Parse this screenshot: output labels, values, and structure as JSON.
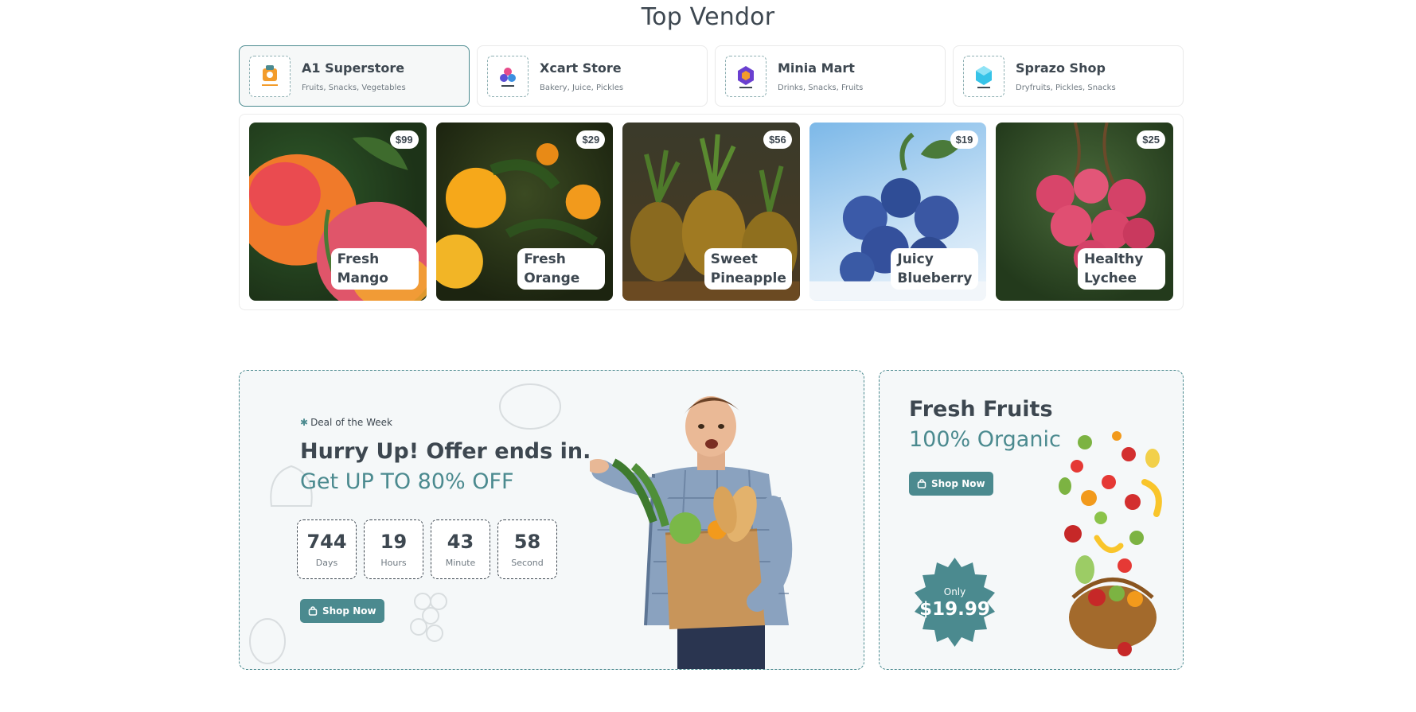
{
  "section_title": "Top Vendor",
  "vendors": [
    {
      "name": "A1 Superstore",
      "categories": "Fruits, Snacks, Vegetables",
      "active": true
    },
    {
      "name": "Xcart Store",
      "categories": "Bakery, Juice, Pickles",
      "active": false
    },
    {
      "name": "Minia Mart",
      "categories": "Drinks, Snacks, Fruits",
      "active": false
    },
    {
      "name": "Sprazo Shop",
      "categories": "Dryfruits, Pickles, Snacks",
      "active": false
    }
  ],
  "products": [
    {
      "name": "Fresh Mango",
      "price": "$99"
    },
    {
      "name": "Fresh Orange",
      "price": "$29"
    },
    {
      "name": "Sweet Pineapple",
      "price": "$56"
    },
    {
      "name": "Juicy Blueberry",
      "price": "$19"
    },
    {
      "name": "Healthy Lychee",
      "price": "$25"
    }
  ],
  "deal": {
    "eyebrow": "Deal of the Week",
    "title": "Hurry Up! Offer ends in.",
    "subtitle": "Get UP TO 80% OFF",
    "countdown": [
      {
        "value": "744",
        "label": "Days"
      },
      {
        "value": "19",
        "label": "Hours"
      },
      {
        "value": "43",
        "label": "Minute"
      },
      {
        "value": "58",
        "label": "Second"
      }
    ],
    "button_label": "Shop Now"
  },
  "fruits_banner": {
    "title": "Fresh Fruits",
    "subtitle": "100% Organic",
    "button_label": "Shop Now",
    "only_label": "Only",
    "price": "$19.99"
  },
  "colors": {
    "accent": "#4b8a8f",
    "text": "#3d4750",
    "muted": "#707a82",
    "panel": "#f5f8f9"
  },
  "icons": {
    "button_icon": "shopping-bag-icon",
    "eyebrow_icon": "star-icon"
  }
}
